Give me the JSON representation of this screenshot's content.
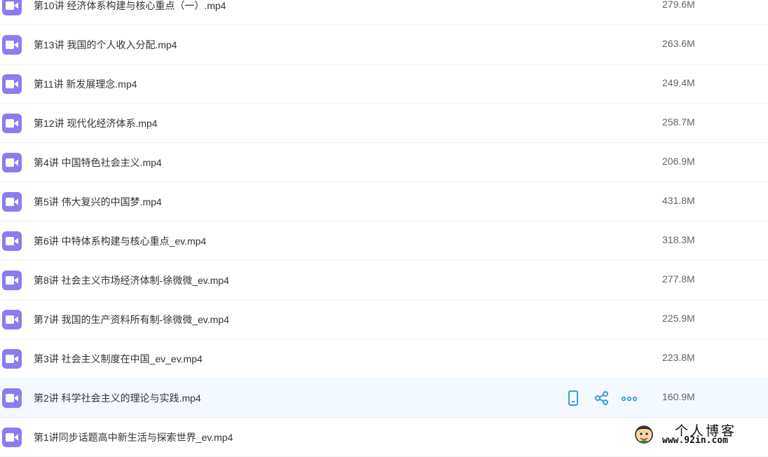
{
  "colors": {
    "file_icon": "#8c7cf2",
    "action_icon": "#3b9ae1",
    "hover_row": "#f4f9ff"
  },
  "files": [
    {
      "name": "第10讲 经济体系构建与核心重点（一）.mp4",
      "size": "279.6M"
    },
    {
      "name": "第13讲 我国的个人收入分配.mp4",
      "size": "263.6M"
    },
    {
      "name": "第11讲 新发展理念.mp4",
      "size": "249.4M"
    },
    {
      "name": "第12讲 现代化经济体系.mp4",
      "size": "258.7M"
    },
    {
      "name": "第4讲 中国特色社会主义.mp4",
      "size": "206.9M"
    },
    {
      "name": "第5讲 伟大复兴的中国梦.mp4",
      "size": "431.8M"
    },
    {
      "name": "第6讲 中特体系构建与核心重点_ev.mp4",
      "size": "318.3M"
    },
    {
      "name": "第8讲 社会主义市场经济体制-徐微微_ev.mp4",
      "size": "277.8M"
    },
    {
      "name": "第7讲 我国的生产资料所有制-徐微微_ev.mp4",
      "size": "225.9M"
    },
    {
      "name": "第3讲 社会主义制度在中国_ev_ev.mp4",
      "size": "223.8M"
    },
    {
      "name": "第2讲 科学社会主义的理论与实践.mp4",
      "size": "160.9M"
    },
    {
      "name": "第1讲同步话题高中新生活与探索世界_ev.mp4",
      "size": ""
    }
  ],
  "row_actions": {
    "icons": [
      "phone-icon",
      "share-icon",
      "more-icon"
    ]
  },
  "watermark": {
    "title": "个人博客",
    "url": "www.92in.com"
  }
}
